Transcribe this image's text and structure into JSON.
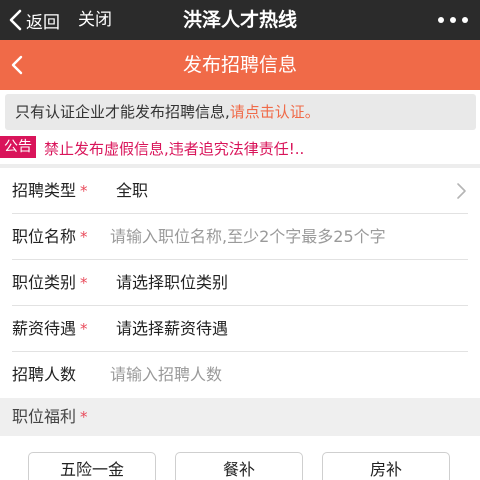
{
  "topbar": {
    "back_label": "返回",
    "close_label": "关闭",
    "title": "洪泽人才热线"
  },
  "header": {
    "title": "发布招聘信息"
  },
  "notice": {
    "text": "只有认证企业才能发布招聘信息,",
    "link": "请点击认证。"
  },
  "announcement": {
    "badge": "公告",
    "text": "禁止发布虚假信息,违者追究法律责任!.."
  },
  "form": {
    "recruit_type": {
      "label": "招聘类型",
      "required": "*",
      "value": "全职"
    },
    "job_name": {
      "label": "职位名称",
      "required": "*",
      "placeholder": "请输入职位名称,至少2个字最多25个字"
    },
    "job_category": {
      "label": "职位类别",
      "required": "*",
      "placeholder": "请选择职位类别"
    },
    "salary": {
      "label": "薪资待遇",
      "required": "*",
      "placeholder": "请选择薪资待遇"
    },
    "headcount": {
      "label": "招聘人数",
      "placeholder": "请输入招聘人数"
    },
    "welfare": {
      "label": "职位福利",
      "required": "*"
    }
  },
  "benefits": [
    "五险一金",
    "餐补",
    "房补"
  ],
  "colors": {
    "topbar": "#2b2b2b",
    "accent": "#f06a48",
    "announce": "#d9145a",
    "required": "#e94b5b"
  }
}
